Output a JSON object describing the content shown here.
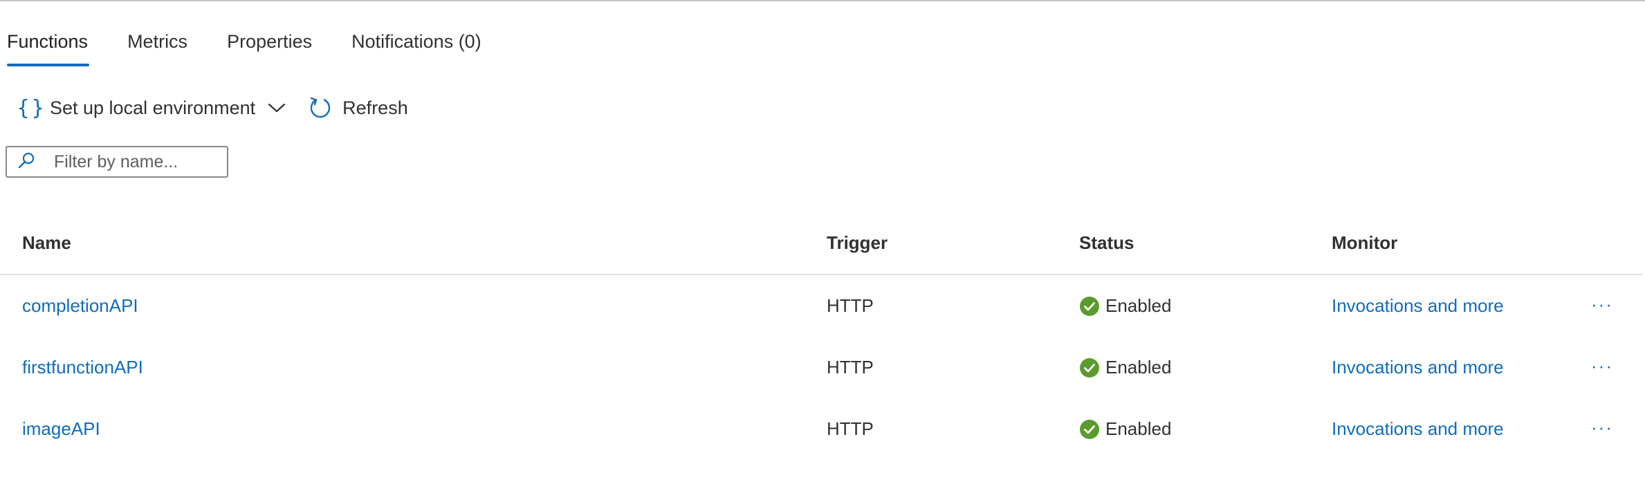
{
  "tabs": [
    {
      "label": "Functions",
      "active": true
    },
    {
      "label": "Metrics",
      "active": false
    },
    {
      "label": "Properties",
      "active": false
    },
    {
      "label": "Notifications (0)",
      "active": false
    }
  ],
  "toolbar": {
    "setup_label": "Set up local environment",
    "refresh_label": "Refresh"
  },
  "filter": {
    "placeholder": "Filter by name...",
    "value": ""
  },
  "table": {
    "columns": [
      "Name",
      "Trigger",
      "Status",
      "Monitor"
    ],
    "rows": [
      {
        "name": "completionAPI",
        "trigger": "HTTP",
        "status": "Enabled",
        "monitor": "Invocations and more",
        "more": "···"
      },
      {
        "name": "firstfunctionAPI",
        "trigger": "HTTP",
        "status": "Enabled",
        "monitor": "Invocations and more",
        "more": "···"
      },
      {
        "name": "imageAPI",
        "trigger": "HTTP",
        "status": "Enabled",
        "monitor": "Invocations and more",
        "more": "···"
      }
    ]
  },
  "icons": {
    "setup": "braces-icon",
    "dropdown": "chevron-down-icon",
    "refresh": "refresh-icon",
    "search": "search-icon",
    "status": "checkmark-circle-icon",
    "more": "more-icon"
  },
  "colors": {
    "accent": "#0f6cbd",
    "success": "#5b9a2c",
    "text": "#323130",
    "border": "#8a8886"
  }
}
